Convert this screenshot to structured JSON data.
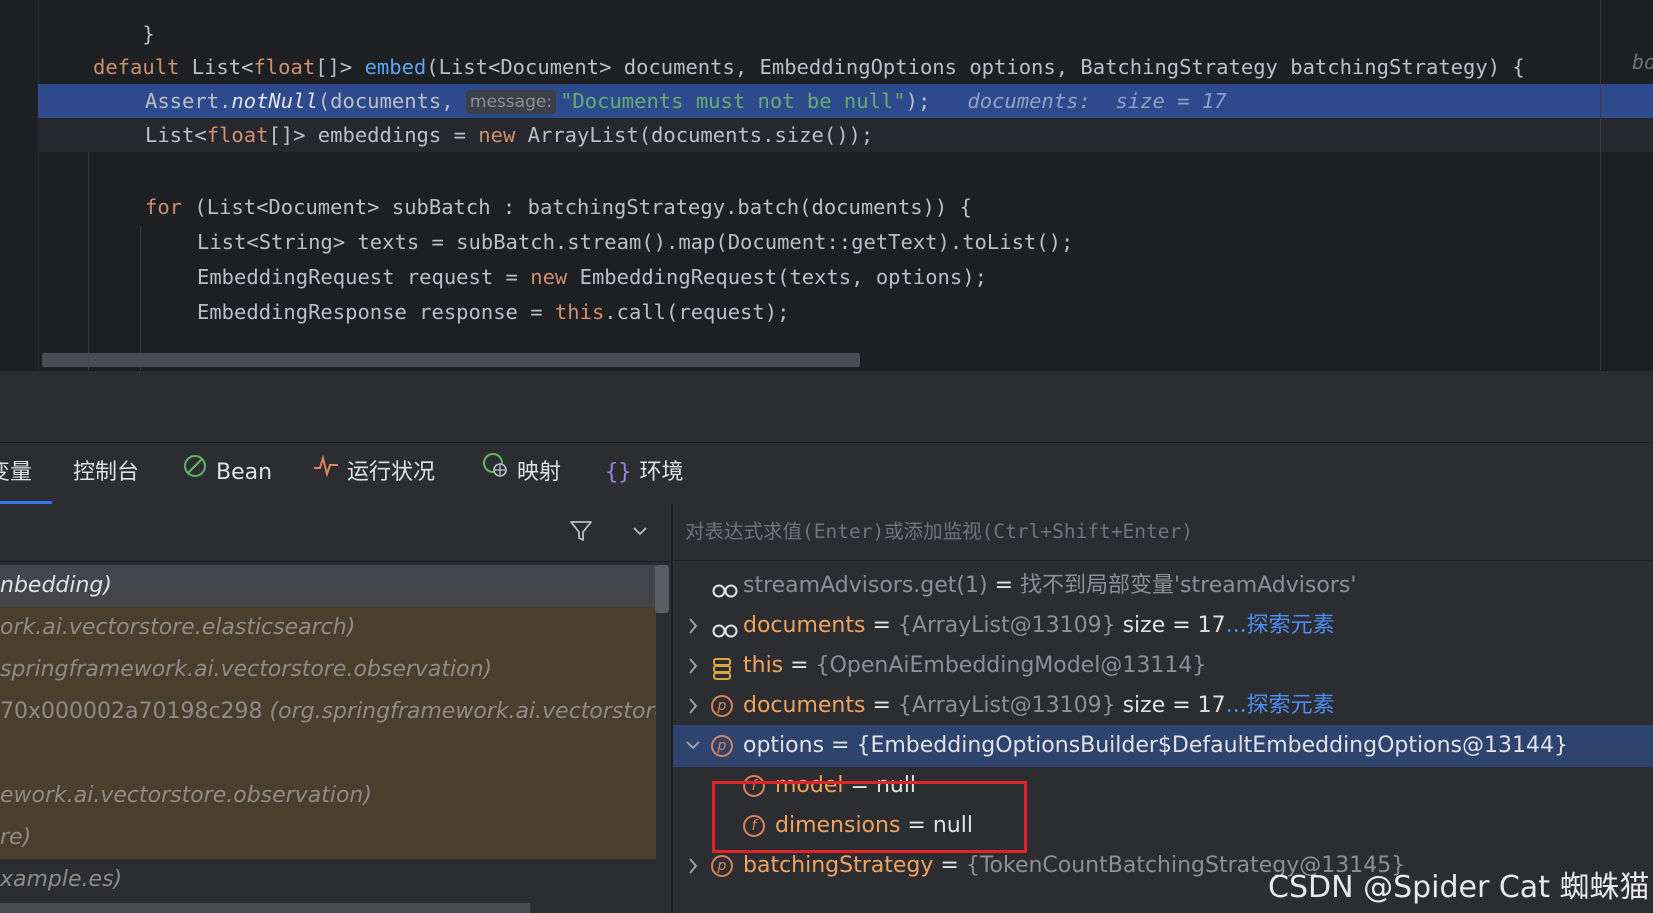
{
  "editor": {
    "lines": [
      {
        "id": "line_close",
        "text": "}"
      },
      {
        "id": "line_signature",
        "kw": "default",
        "type_prefix": "List<",
        "type_kw": "float",
        "type_suffix": "[]>",
        "fn": "embed",
        "params": "(List<Document> documents, EmbeddingOptions options, BatchingStrategy batchingStrategy) {"
      },
      {
        "id": "line_assert",
        "pre": "Assert.",
        "fn": "notNull",
        "args": "(documents, ",
        "hint": "message:",
        "str": "\"Documents must not be null\"",
        "tail": ");",
        "inline_value": "documents:  size = 17"
      },
      {
        "id": "line_embeddings",
        "pre": "List<",
        "type_kw": "float",
        "mid": "[]> embeddings = ",
        "kw": "new",
        "tail": " ArrayList(documents.size());"
      },
      {
        "id": "line_for",
        "kw": "for",
        "tail": " (List<Document> subBatch : batchingStrategy.batch(documents)) {"
      },
      {
        "id": "line_texts",
        "text": "List<String> texts = subBatch.stream().map(Document::getText).toList();"
      },
      {
        "id": "line_request",
        "pre": "EmbeddingRequest request = ",
        "kw": "new",
        "tail": " EmbeddingRequest(texts, options);"
      },
      {
        "id": "line_response",
        "pre": "EmbeddingResponse response = ",
        "kw": "this",
        "tail": ".call(request);"
      }
    ],
    "right_hint": "bo"
  },
  "tabs": [
    {
      "label": "变量",
      "icon": "none",
      "active": true
    },
    {
      "label": "控制台",
      "icon": "none",
      "active": false
    },
    {
      "label": "Bean",
      "icon": "bean-icon",
      "active": false
    },
    {
      "label": "运行状况",
      "icon": "pulse-icon",
      "active": false
    },
    {
      "label": "映射",
      "icon": "mapping-icon",
      "active": false
    },
    {
      "label": "环境",
      "icon": "braces-icon",
      "active": false
    }
  ],
  "frames": {
    "rows": [
      {
        "pre": "",
        "text": "nbedding)",
        "style": "selected"
      },
      {
        "pre": "",
        "text": "ork.ai.vectorstore.elasticsearch)",
        "style": "lib"
      },
      {
        "pre": "",
        "text": "springframework.ai.vectorstore.observation)",
        "style": "lib"
      },
      {
        "pre": "70x000002a70198c298 ",
        "text": "(org.springframework.ai.vectorstore.obser",
        "style": "lib"
      },
      {
        "pre": "",
        "text": "",
        "style": "lib"
      },
      {
        "pre": "",
        "text": "ework.ai.vectorstore.observation)",
        "style": "lib"
      },
      {
        "pre": "",
        "text": "re)",
        "style": "lib"
      },
      {
        "pre": "",
        "text": "xample.es)",
        "style": "plain"
      }
    ]
  },
  "evaluate": {
    "placeholder": "对表达式求值(Enter)或添加监视(Ctrl+Shift+Enter)"
  },
  "variables": [
    {
      "icon": "watch-icon",
      "expandable": false,
      "name": "streamAdvisors.get(1)",
      "eq": " = ",
      "value": "找不到局部变量'streamAdvisors'",
      "name_style": "vgray",
      "value_style": "vgray",
      "depth": 0
    },
    {
      "icon": "watch-icon",
      "expandable": true,
      "name": "documents",
      "eq": " = ",
      "value": "{ArrayList@13109}",
      "extra": " size = 17",
      "link": "...探索元素",
      "depth": 0
    },
    {
      "icon": "stack-icon",
      "expandable": true,
      "name": "this",
      "eq": " = ",
      "value": "{OpenAiEmbeddingModel@13114}",
      "depth": 0
    },
    {
      "icon": "param-icon",
      "badge": "p",
      "expandable": true,
      "name": "documents",
      "eq": " = ",
      "value": "{ArrayList@13109}",
      "extra": " size = 17",
      "link": "...探索元素",
      "depth": 0
    },
    {
      "icon": "param-icon",
      "badge": "p",
      "expandable": true,
      "expanded": true,
      "selected": true,
      "name": "options",
      "eq": " = ",
      "value": "{EmbeddingOptionsBuilder$DefaultEmbeddingOptions@13144}",
      "name_style": "vwhite",
      "value_style": "vwhite",
      "depth": 0
    },
    {
      "icon": "field-icon",
      "badge": "f",
      "expandable": false,
      "name": "model",
      "eq": " = ",
      "value": "null",
      "value_style": "vwhite",
      "depth": 1
    },
    {
      "icon": "field-icon",
      "badge": "f",
      "expandable": false,
      "name": "dimensions",
      "eq": " = ",
      "value": "null",
      "value_style": "vwhite",
      "depth": 1
    },
    {
      "icon": "param-icon",
      "badge": "p",
      "expandable": true,
      "name": "batchingStrategy",
      "eq": " = ",
      "value": "{TokenCountBatchingStrategy@13145}",
      "depth": 0
    }
  ],
  "watermark": "CSDN @Spider Cat 蜘蛛猫"
}
